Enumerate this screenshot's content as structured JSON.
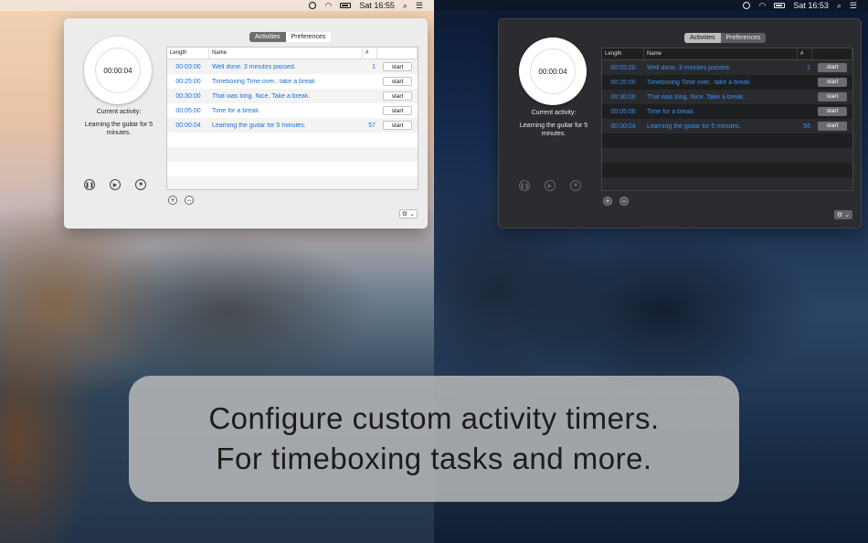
{
  "light": {
    "menubar": {
      "time": "Sat 16:55"
    },
    "timer": "00:00:04",
    "current_label": "Current activity:",
    "current_value": "Learning the guitar for 5 minutes.",
    "tabs": [
      "Activities",
      "Preferences"
    ],
    "columns": [
      "Length",
      "Name",
      "#",
      ""
    ],
    "rows": [
      {
        "length": "00:03:00",
        "name": "Well done. 3 minutes passed.",
        "count": "1",
        "action": "start"
      },
      {
        "length": "00:25:00",
        "name": "Timeboxing Time over.. take a break",
        "count": "",
        "action": "start"
      },
      {
        "length": "00:30:00",
        "name": "That was long. Nice. Take a break.",
        "count": "",
        "action": "start"
      },
      {
        "length": "00:05:00",
        "name": "Time for a break.",
        "count": "",
        "action": "start"
      },
      {
        "length": "00:00:04",
        "name": "Learning the guitar for 5 minutes.",
        "count": "57",
        "action": "start"
      }
    ]
  },
  "dark": {
    "menubar": {
      "time": "Sat 16:53"
    },
    "timer": "00:00:04",
    "current_label": "Current activity:",
    "current_value": "Learning the guitar for 5 minutes.",
    "tabs": [
      "Activities",
      "Preferences"
    ],
    "columns": [
      "Length",
      "Name",
      "#",
      ""
    ],
    "rows": [
      {
        "length": "00:03:00",
        "name": "Well done. 3 minutes passed.",
        "count": "1",
        "action": "start"
      },
      {
        "length": "00:25:00",
        "name": "Timeboxing Time over.. take a break",
        "count": "",
        "action": "start"
      },
      {
        "length": "00:30:00",
        "name": "That was long. Nice. Take a break.",
        "count": "",
        "action": "start"
      },
      {
        "length": "00:05:00",
        "name": "Time for a break.",
        "count": "",
        "action": "start"
      },
      {
        "length": "00:00:04",
        "name": "Learning the guitar for 5 minutes.",
        "count": "56",
        "action": "start"
      }
    ]
  },
  "icons": {
    "menubar": [
      "clock-icon",
      "wifi-icon",
      "battery-icon",
      "search-icon",
      "list-icon"
    ],
    "controls": [
      "pause-icon",
      "play-icon",
      "stop-icon"
    ],
    "table": [
      "add-icon",
      "remove-icon",
      "gear-icon"
    ]
  },
  "banner": {
    "line1": "Configure custom activity timers.",
    "line2": "For timeboxing tasks and more."
  }
}
